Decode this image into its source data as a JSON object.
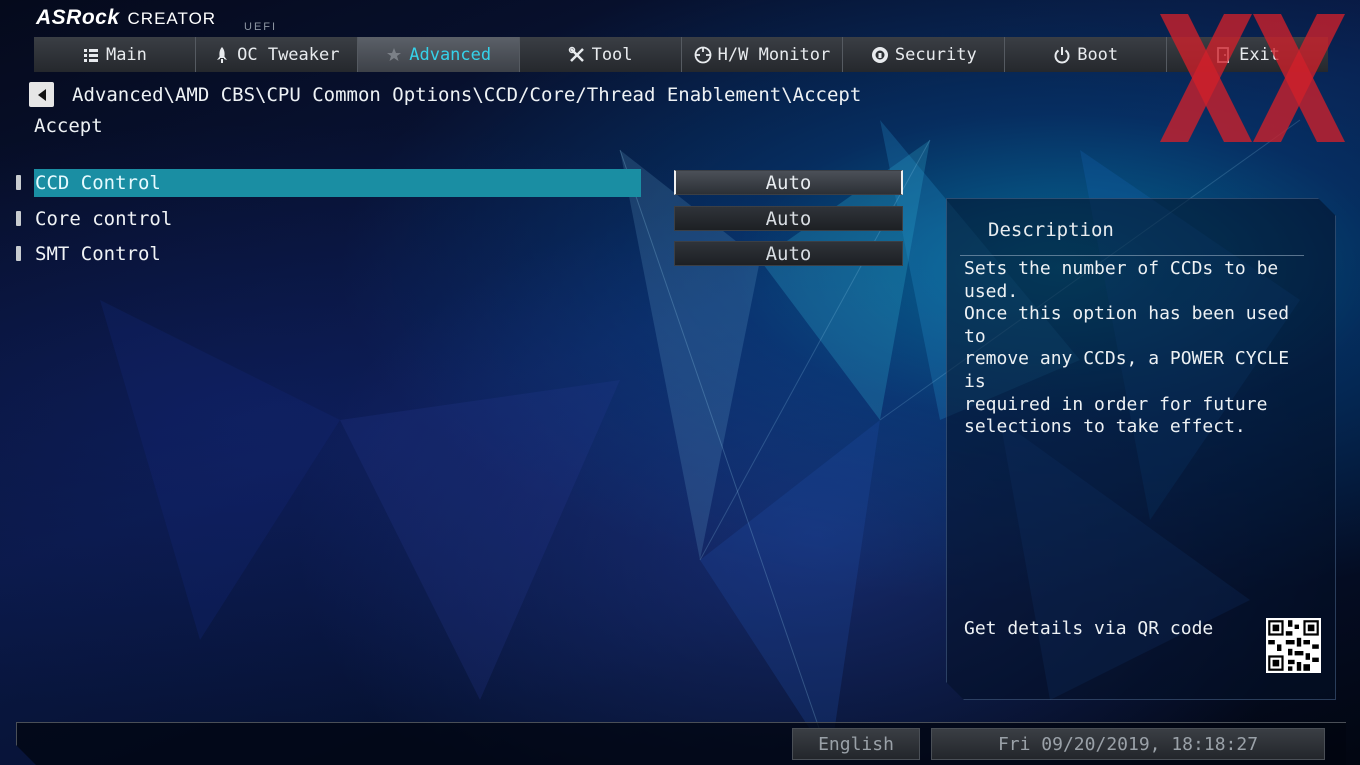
{
  "header": {
    "brand": "ASRock",
    "product": "CREATOR",
    "uefi": "UEFI"
  },
  "tabs": [
    {
      "label": "Main",
      "icon": "list-icon",
      "active": false
    },
    {
      "label": "OC Tweaker",
      "icon": "rocket-icon",
      "active": false
    },
    {
      "label": "Advanced",
      "icon": "star-icon",
      "active": true
    },
    {
      "label": "Tool",
      "icon": "tools-icon",
      "active": false
    },
    {
      "label": "H/W Monitor",
      "icon": "crosshair-icon",
      "active": false
    },
    {
      "label": "Security",
      "icon": "shield-icon",
      "active": false
    },
    {
      "label": "Boot",
      "icon": "power-icon",
      "active": false
    },
    {
      "label": "Exit",
      "icon": "exit-icon",
      "active": false
    }
  ],
  "breadcrumb": "Advanced\\AMD CBS\\CPU Common Options\\CCD/Core/Thread Enablement\\Accept",
  "page_title": "Accept",
  "settings": [
    {
      "label": "CCD Control",
      "value": "Auto",
      "selected": true
    },
    {
      "label": "Core control",
      "value": "Auto",
      "selected": false
    },
    {
      "label": "SMT Control",
      "value": "Auto",
      "selected": false
    }
  ],
  "description": {
    "title": "Description",
    "text": "Sets the number of CCDs to be used.\nOnce this option has been used to\nremove any CCDs, a POWER CYCLE is\nrequired in order for future\nselections to take effect.",
    "qr_label": "Get details via QR code"
  },
  "footer": {
    "language": "English",
    "datetime": "Fri 09/20/2019, 18:18:27"
  },
  "colors": {
    "accent": "#35d2ea",
    "selection": "#1a8ea3",
    "watermark": "#d0202a"
  }
}
